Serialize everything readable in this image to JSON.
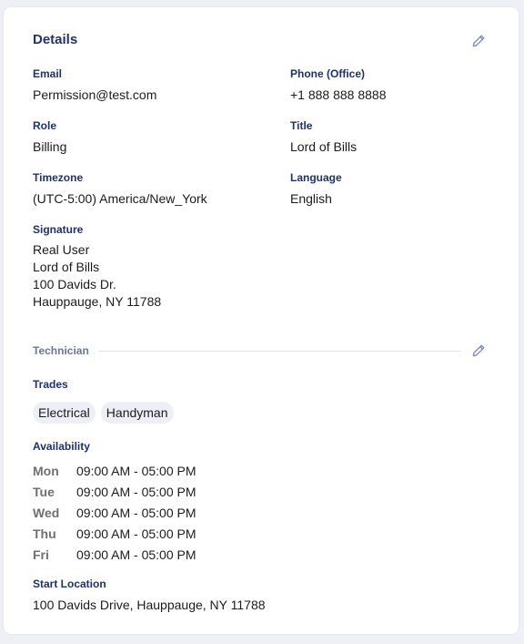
{
  "details": {
    "title": "Details",
    "fields": {
      "email": {
        "label": "Email",
        "value": "Permission@test.com"
      },
      "phone": {
        "label": "Phone (Office)",
        "value": "+1 888 888 8888"
      },
      "role": {
        "label": "Role",
        "value": "Billing"
      },
      "title": {
        "label": "Title",
        "value": "Lord of Bills"
      },
      "timezone": {
        "label": "Timezone",
        "value": "(UTC-5:00) America/New_York"
      },
      "language": {
        "label": "Language",
        "value": "English"
      }
    },
    "signature": {
      "label": "Signature",
      "lines": [
        "Real User",
        "Lord of Bills",
        "100 Davids Dr.",
        "Hauppauge, NY 11788"
      ]
    }
  },
  "technician": {
    "section_label": "Technician",
    "trades": {
      "label": "Trades",
      "items": [
        "Electrical",
        "Handyman"
      ]
    },
    "availability": {
      "label": "Availability",
      "rows": [
        {
          "day": "Mon",
          "hours": "09:00 AM - 05:00 PM"
        },
        {
          "day": "Tue",
          "hours": "09:00 AM - 05:00 PM"
        },
        {
          "day": "Wed",
          "hours": "09:00 AM - 05:00 PM"
        },
        {
          "day": "Thu",
          "hours": "09:00 AM - 05:00 PM"
        },
        {
          "day": "Fri",
          "hours": "09:00 AM - 05:00 PM"
        }
      ]
    },
    "start_location": {
      "label": "Start Location",
      "value": "100 Davids Drive, Hauppauge, NY 11788"
    }
  },
  "icons": {
    "edit": "pencil-icon"
  },
  "colors": {
    "heading": "#1e3170",
    "section_label": "#6b759a",
    "chip_bg": "#eceff6",
    "icon": "#7b86b3"
  }
}
